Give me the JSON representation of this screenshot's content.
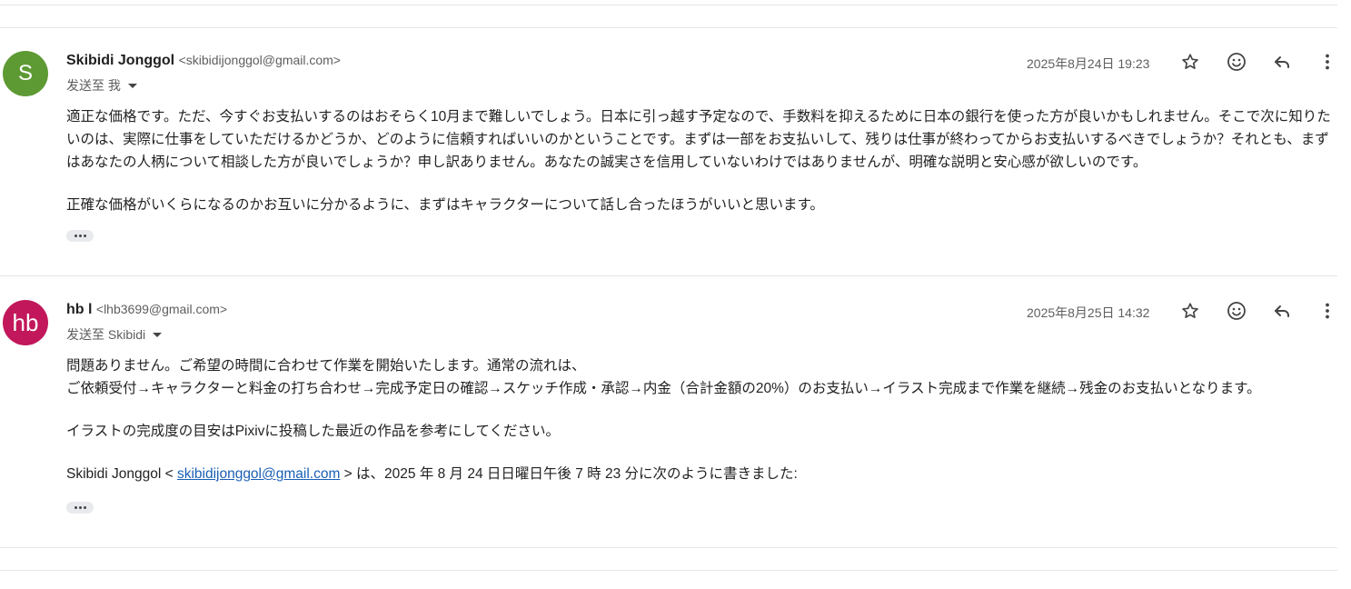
{
  "messages": [
    {
      "avatar_letter": "S",
      "avatar_color": "#5e9a34",
      "sender_name": "Skibidi Jonggol",
      "sender_email": "<skibidijonggol@gmail.com>",
      "to_label": "发送至 我",
      "date": "2025年8月24日 19:23",
      "body": [
        "適正な価格です。ただ、今すぐお支払いするのはおそらく10月まで難しいでしょう。日本に引っ越す予定なので、手数料を抑えるために日本の銀行を使った方が良いかもしれません。そこで次に知りたいのは、実際に仕事をしていただけるかどうか、どのように信頼すればいいのかということです。まずは一部をお支払いして、残りは仕事が終わってからお支払いするべきでしょうか？それとも、まずはあなたの人柄について相談した方が良いでしょうか？申し訳ありません。あなたの誠実さを信用していないわけではありませんが、明確な説明と安心感が欲しいのです。",
        "正確な価格がいくらになるのかお互いに分かるように、まずはキャラクターについて話し合ったほうがいいと思います。"
      ]
    },
    {
      "avatar_letter": "hb",
      "avatar_color": "#c2185b",
      "sender_name": "hb l",
      "sender_email": "<lhb3699@gmail.com>",
      "to_label": "发送至 Skibidi",
      "date": "2025年8月25日 14:32",
      "body_line1": "問題ありません。ご希望の時間に合わせて作業を開始いたします。通常の流れは、",
      "body_line2": "ご依頼受付→キャラクターと料金の打ち合わせ→完成予定日の確認→スケッチ作成・承認→内金（合計金額の20%）のお支払い→イラスト完成まで作業を継続→残金のお支払いとなります。",
      "body_para2": "イラストの完成度の目安はPixivに投稿した最近の作品を参考にしてください。",
      "quote_prefix": "Skibidi Jonggol < ",
      "quote_email": "skibidijonggol@gmail.com",
      "quote_suffix": " > は、2025 年 8 月 24 日日曜日午後 7 時 23 分に次のように書きました:"
    }
  ],
  "icons": [
    "star-icon",
    "smiley-icon",
    "reply-icon",
    "more-vert-icon"
  ]
}
